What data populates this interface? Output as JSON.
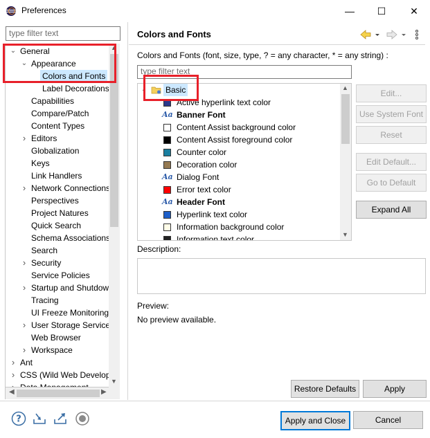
{
  "window": {
    "title": "Preferences",
    "minimize": "—",
    "maximize": "☐",
    "close": "✕"
  },
  "left": {
    "filter_placeholder": "type filter text",
    "tree": [
      {
        "label": "General",
        "indent": 0,
        "twisty": "down"
      },
      {
        "label": "Appearance",
        "indent": 1,
        "twisty": "down"
      },
      {
        "label": "Colors and Fonts",
        "indent": 2,
        "twisty": "",
        "selected": true
      },
      {
        "label": "Label Decorations",
        "indent": 2,
        "twisty": ""
      },
      {
        "label": "Capabilities",
        "indent": 1,
        "twisty": ""
      },
      {
        "label": "Compare/Patch",
        "indent": 1,
        "twisty": ""
      },
      {
        "label": "Content Types",
        "indent": 1,
        "twisty": ""
      },
      {
        "label": "Editors",
        "indent": 1,
        "twisty": "right"
      },
      {
        "label": "Globalization",
        "indent": 1,
        "twisty": ""
      },
      {
        "label": "Keys",
        "indent": 1,
        "twisty": ""
      },
      {
        "label": "Link Handlers",
        "indent": 1,
        "twisty": ""
      },
      {
        "label": "Network Connections",
        "indent": 1,
        "twisty": "right"
      },
      {
        "label": "Perspectives",
        "indent": 1,
        "twisty": ""
      },
      {
        "label": "Project Natures",
        "indent": 1,
        "twisty": ""
      },
      {
        "label": "Quick Search",
        "indent": 1,
        "twisty": ""
      },
      {
        "label": "Schema Associations",
        "indent": 1,
        "twisty": ""
      },
      {
        "label": "Search",
        "indent": 1,
        "twisty": ""
      },
      {
        "label": "Security",
        "indent": 1,
        "twisty": "right"
      },
      {
        "label": "Service Policies",
        "indent": 1,
        "twisty": ""
      },
      {
        "label": "Startup and Shutdown",
        "indent": 1,
        "twisty": "right"
      },
      {
        "label": "Tracing",
        "indent": 1,
        "twisty": ""
      },
      {
        "label": "UI Freeze Monitoring",
        "indent": 1,
        "twisty": ""
      },
      {
        "label": "User Storage Service",
        "indent": 1,
        "twisty": "right"
      },
      {
        "label": "Web Browser",
        "indent": 1,
        "twisty": ""
      },
      {
        "label": "Workspace",
        "indent": 1,
        "twisty": "right"
      },
      {
        "label": "Ant",
        "indent": 0,
        "twisty": "right"
      },
      {
        "label": "CSS (Wild Web Developer)",
        "indent": 0,
        "twisty": "right"
      },
      {
        "label": "Data Management",
        "indent": 0,
        "twisty": "right"
      }
    ]
  },
  "right": {
    "page_title": "Colors and Fonts",
    "description": "Colors and Fonts (font, size, type, ? = any character, * = any string) :",
    "filter_placeholder": "type filter text",
    "group_label": "Basic",
    "items": [
      {
        "label": "Active hyperlink text color",
        "kind": "color",
        "color": "#2b3a8c",
        "bold": false
      },
      {
        "label": "Banner Font",
        "kind": "font",
        "bold": true
      },
      {
        "label": "Content Assist background color",
        "kind": "color",
        "color": "#ffffff",
        "bold": false
      },
      {
        "label": "Content Assist foreground color",
        "kind": "color",
        "color": "#000000",
        "bold": false
      },
      {
        "label": "Counter color",
        "kind": "color",
        "color": "#1a7fa0",
        "bold": false
      },
      {
        "label": "Decoration color",
        "kind": "color",
        "color": "#957a52",
        "bold": false
      },
      {
        "label": "Dialog Font",
        "kind": "font",
        "bold": false
      },
      {
        "label": "Error text color",
        "kind": "color",
        "color": "#ff0000",
        "bold": false
      },
      {
        "label": "Header Font",
        "kind": "font",
        "bold": true
      },
      {
        "label": "Hyperlink text color",
        "kind": "color",
        "color": "#1e5fc8",
        "bold": false
      },
      {
        "label": "Information background color",
        "kind": "color",
        "color": "#fffde8",
        "bold": false
      },
      {
        "label": "Information text color",
        "kind": "color",
        "color": "#222222",
        "bold": false
      }
    ],
    "buttons": {
      "edit": "Edit...",
      "use_system_font": "Use System Font",
      "reset": "Reset",
      "edit_default": "Edit Default...",
      "go_to_default": "Go to Default",
      "expand_all": "Expand All"
    },
    "description_label": "Description:",
    "preview_label": "Preview:",
    "preview_text": "No preview available.",
    "restore_defaults": "Restore Defaults",
    "apply": "Apply"
  },
  "footer": {
    "apply_and_close": "Apply and Close",
    "cancel": "Cancel"
  },
  "colors": {
    "accent": "#0078d7",
    "highlight": "#e8202a",
    "selection": "#cce8ff"
  }
}
